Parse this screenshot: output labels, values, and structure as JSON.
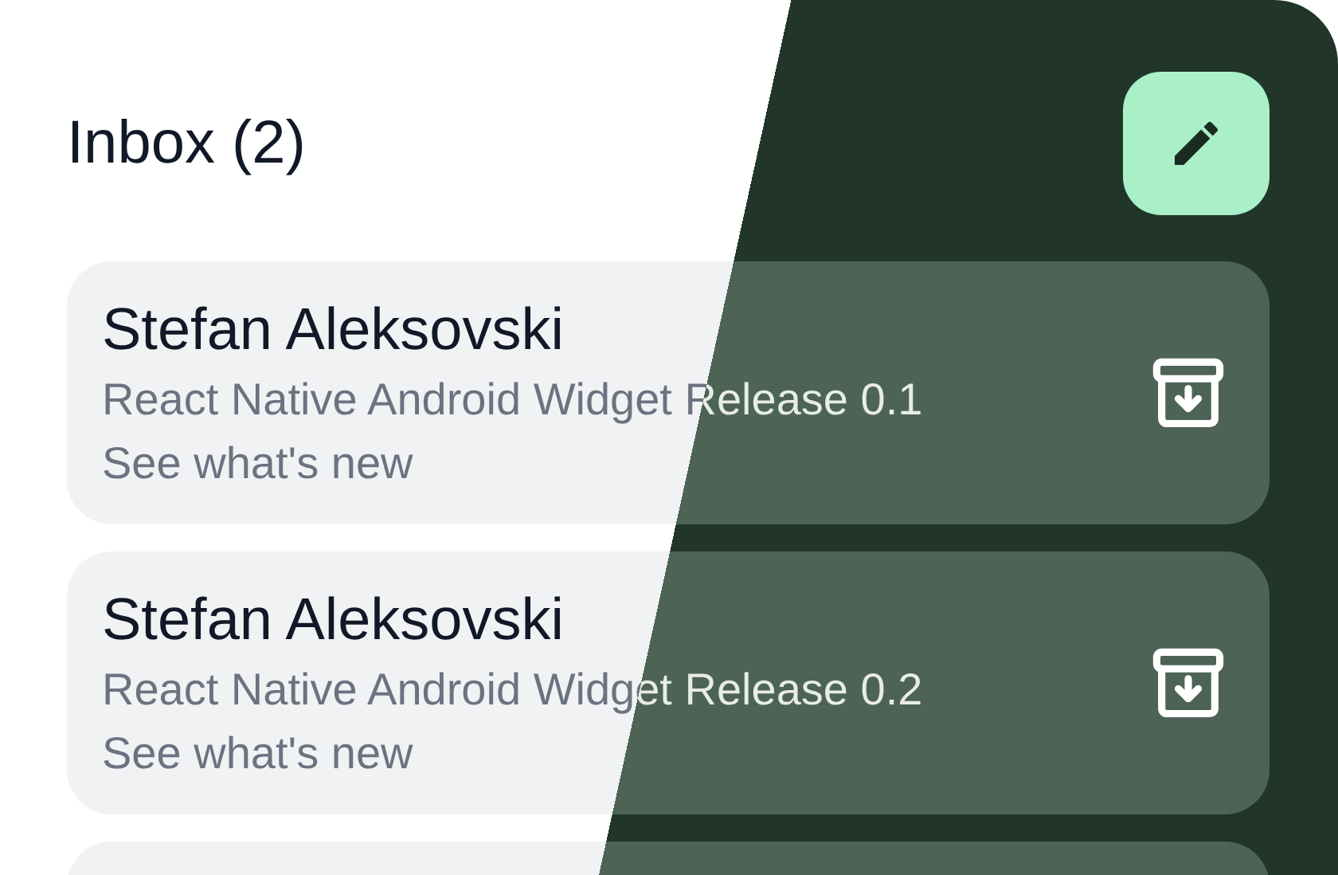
{
  "header": {
    "title": "Inbox (2)"
  },
  "messages": [
    {
      "sender": "Stefan Aleksovski",
      "subject": "React Native Android Widget Release 0.1",
      "preview": "See what's new"
    },
    {
      "sender": "Stefan Aleksovski",
      "subject": "React Native Android Widget Release 0.2",
      "preview": "See what's new"
    }
  ]
}
